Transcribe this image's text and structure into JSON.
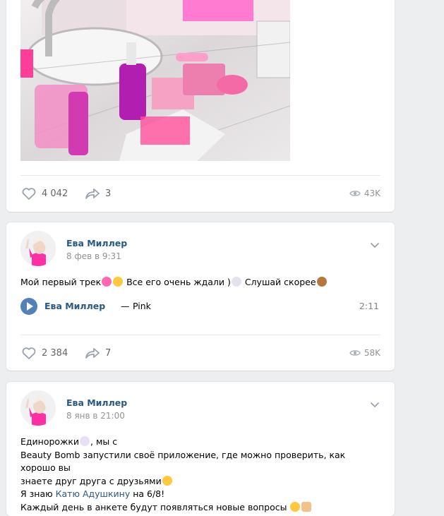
{
  "posts": [
    {
      "likes": "4 042",
      "shares": "3",
      "views": "43K"
    },
    {
      "author": "Ева Миллер",
      "date": "8 фев в 9:31",
      "text": [
        "Мой первый трек",
        " Все его очень ждали )",
        " Слушай скорее"
      ],
      "audio": {
        "artist": "Ева Миллер",
        "separator": "—",
        "title": "Pink",
        "duration": "2:11"
      },
      "likes": "2 384",
      "shares": "7",
      "views": "58K"
    },
    {
      "author": "Ева Миллер",
      "date": "8 янв в 21:00",
      "lines": {
        "l1": "Единорожки",
        "l1b": ", мы с",
        "l2": "Beauty Bomb запустили своё приложение, где можно проверить, как хорошо вы",
        "l3": "знаете друг друга с друзьями",
        "l4a": "Я знаю ",
        "l4link": "Катю Адушкину",
        "l4b": " на 6/8!",
        "l5": "Каждый день в анкете будут появляться новые вопросы"
      }
    }
  ],
  "icons": {
    "like": "heart-icon",
    "share": "share-arrow-icon",
    "views": "eye-icon",
    "menu": "chevron-down-icon",
    "play": "play-icon"
  },
  "colors": {
    "link": "#2a5885",
    "accent": "#5181b8",
    "muted": "#939393",
    "background": "#edeef0"
  }
}
